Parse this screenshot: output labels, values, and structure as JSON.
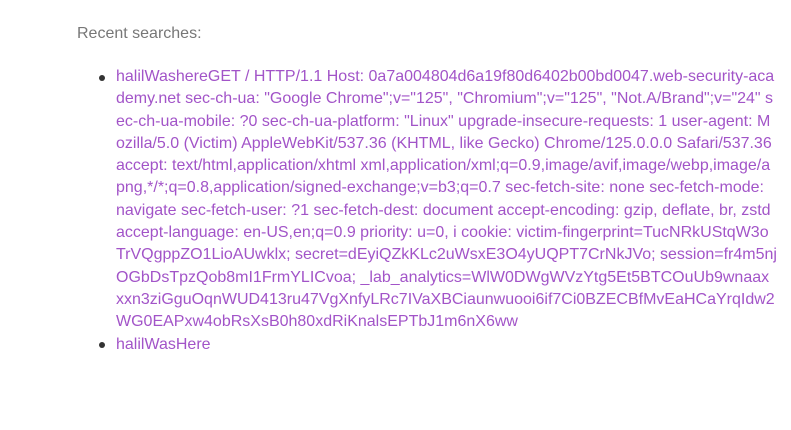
{
  "recent_searches": {
    "heading": "Recent searches:",
    "items": [
      {
        "text": "halilWashereGET / HTTP/1.1 Host: 0a7a004804d6a19f80d6402b00bd0047.web-security-academy.net sec-ch-ua: \"Google Chrome\";v=\"125\", \"Chromium\";v=\"125\", \"Not.A/Brand\";v=\"24\" sec-ch-ua-mobile: ?0 sec-ch-ua-platform: \"Linux\" upgrade-insecure-requests: 1 user-agent: Mozilla/5.0 (Victim) AppleWebKit/537.36 (KHTML, like Gecko) Chrome/125.0.0.0 Safari/537.36 accept: text/html,application/xhtml xml,application/xml;q=0.9,image/avif,image/webp,image/apng,*/*;q=0.8,application/signed-exchange;v=b3;q=0.7 sec-fetch-site: none sec-fetch-mode: navigate sec-fetch-user: ?1 sec-fetch-dest: document accept-encoding: gzip, deflate, br, zstd accept-language: en-US,en;q=0.9 priority: u=0, i cookie: victim-fingerprint=TucNRkUStqW3oTrVQgppZO1LioAUwklx; secret=dEyiQZkKLc2uWsxE3O4yUQPT7CrNkJVo; session=fr4m5njOGbDsTpzQob8mI1FrmYLICvoa; _lab_analytics=WlW0DWgWVzYtg5Et5BTCOuUb9wnaaxxxn3ziGguOqnWUD413ru47VgXnfyLRc7IVaXBCiaunwuooi6if7Ci0BZECBfMvEaHCaYrqIdw2WG0EAPxw4obRsXsB0h80xdRiKnalsEPTbJ1m6nX6ww"
      },
      {
        "text": "halilWasHere"
      }
    ]
  },
  "colors": {
    "link": "#a254c8",
    "heading": "#777777",
    "bullet": "#333333",
    "background": "#ffffff"
  }
}
